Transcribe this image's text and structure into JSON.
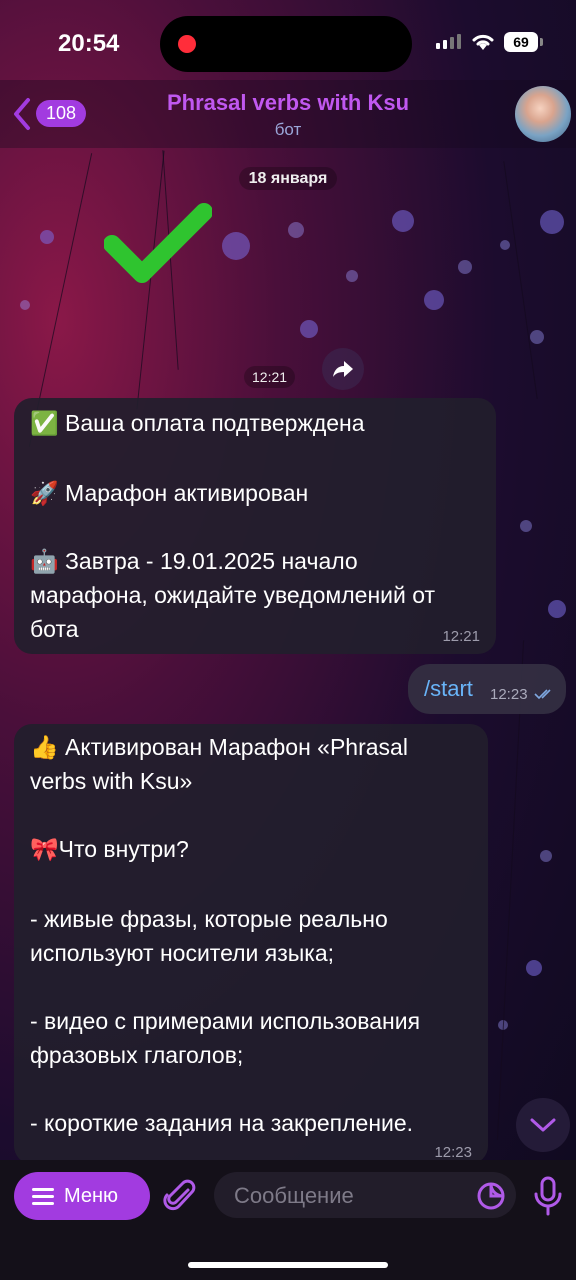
{
  "status_bar": {
    "time": "20:54",
    "battery": "69"
  },
  "header": {
    "back_count": "108",
    "title": "Phrasal verbs with Ksu",
    "subtitle": "бот"
  },
  "chat": {
    "date": "18 января",
    "sticker_time": "12:21",
    "message1": {
      "lines": [
        "✅ Ваша оплата подтверждена",
        "🚀 Марафон активирован",
        "🤖 Завтра - 19.01.2025 начало",
        "марафона, ожидайте уведомлений от",
        "бота"
      ],
      "time": "12:21"
    },
    "outgoing": {
      "text": "/start",
      "time": "12:23"
    },
    "message2": {
      "lines": [
        "👍 Активирован Марафон «Phrasal",
        "verbs with Ksu»",
        "🎀Что внутри?",
        "- живые фразы, которые реально",
        "используют носители языка;",
        "- видео с примерами использования",
        "фразовых глаголов;",
        "- короткие задания на закрепление."
      ],
      "time": "12:23"
    }
  },
  "input_bar": {
    "menu_label": "Меню",
    "placeholder": "Сообщение"
  },
  "colors": {
    "accent": "#a23be0",
    "title": "#c058f0",
    "link": "#69b4f8"
  },
  "icons": [
    "back-chevron-icon",
    "check-sticker-icon",
    "forward-icon",
    "read-ticks-icon",
    "chevron-down-icon",
    "menu-icon",
    "attach-clip-icon",
    "sticker-icon",
    "microphone-icon",
    "wifi-icon",
    "signal-icon"
  ]
}
